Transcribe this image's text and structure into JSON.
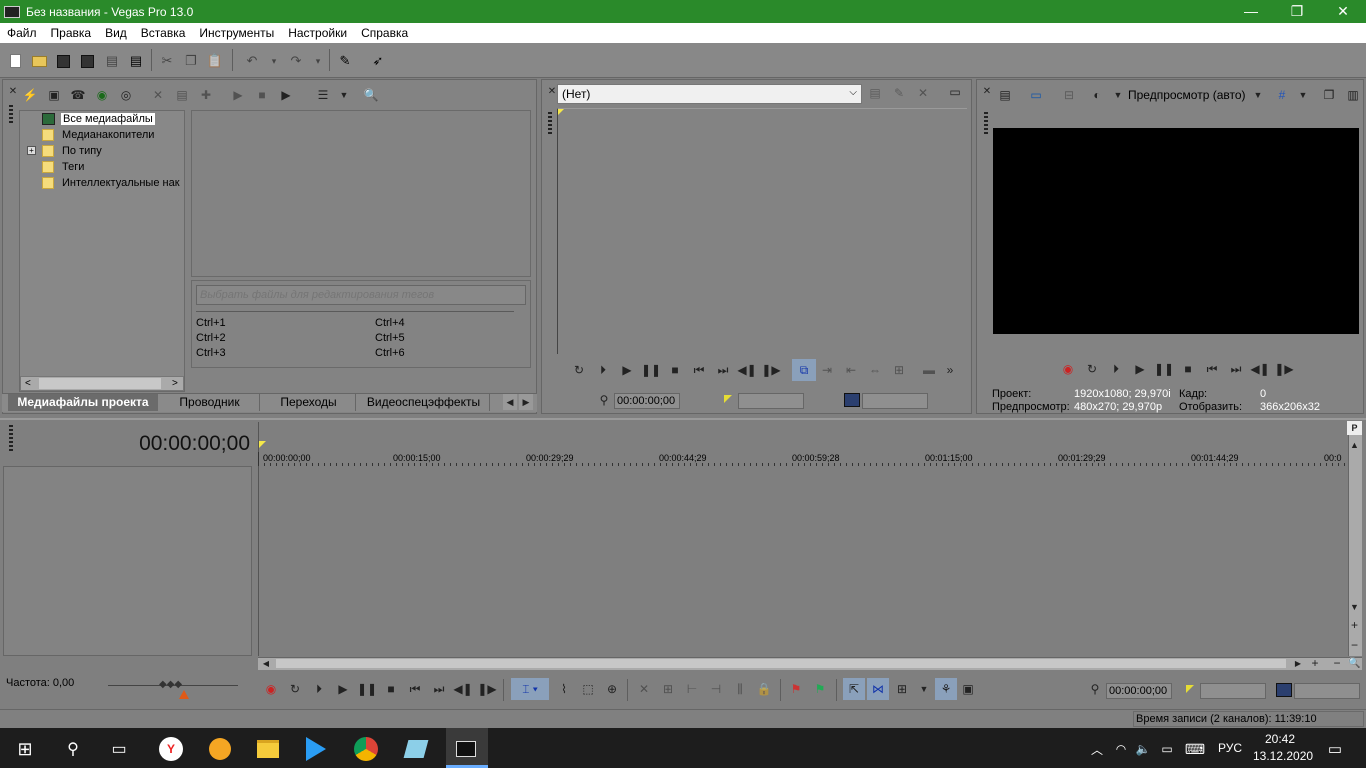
{
  "window": {
    "title": "Без названия - Vegas Pro 13.0",
    "minimize": "—",
    "maximize": "❐",
    "close": "✕"
  },
  "menu": [
    "Файл",
    "Правка",
    "Вид",
    "Вставка",
    "Инструменты",
    "Настройки",
    "Справка"
  ],
  "explorer": {
    "tree": [
      "Все медиафайлы",
      "Медианакопители",
      "По типу",
      "Теги",
      "Интеллектуальные нак"
    ],
    "expand": "+",
    "tag_placeholder": "Выбрать файлы для редактирования тегов",
    "shortcuts": [
      "Ctrl+1",
      "Ctrl+4",
      "Ctrl+2",
      "Ctrl+5",
      "Ctrl+3",
      "Ctrl+6"
    ]
  },
  "tabs": [
    "Медиафайлы проекта",
    "Проводник",
    "Переходы",
    "Видеоспецэффекты"
  ],
  "trimmer": {
    "dropdown_value": "(Нет)",
    "timecode": "00:00:00;00"
  },
  "preview": {
    "mode_label": "Предпросмотр (авто)",
    "project_label": "Проект:",
    "project_value": "1920x1080; 29,970i",
    "preview_label": "Предпросмотр:",
    "preview_value": "480x270; 29,970p",
    "frame_label": "Кадр:",
    "frame_value": "0",
    "display_label": "Отобразить:",
    "display_value": "366x206x32"
  },
  "timeline": {
    "main_timecode": "00:00:00;00",
    "ruler": [
      "00:00:00;00",
      "00:00:15;00",
      "00:00:29;29",
      "00:00:44;29",
      "00:00:59;28",
      "00:01:15;00",
      "00:01:29;29",
      "00:01:44;29",
      "00:0"
    ],
    "rate_label": "Частота: 0,00",
    "bottom_timecode": "00:00:00;00",
    "record_time": "Время записи (2 каналов): 11:39:10"
  },
  "taskbar": {
    "lang": "РУС",
    "time": "20:42",
    "date": "13.12.2020"
  },
  "colors": {
    "titlebar": "#2a8a2a",
    "panel": "#838383",
    "preview_bg": "#000000",
    "taskbar": "#1d1d1d"
  }
}
